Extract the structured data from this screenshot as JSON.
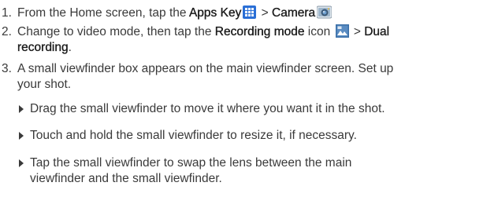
{
  "steps": [
    {
      "num": "1.",
      "p1": "From the Home screen, tap the ",
      "apps_key": "Apps Key",
      "p2": " > ",
      "camera": "Camera"
    },
    {
      "num": "2.",
      "p1": "Change to video mode, then tap the ",
      "recording_mode": "Recording mode",
      "p2": " icon ",
      "p3": " > ",
      "dual_recording_a": "Dual",
      "dual_recording_b": "recording",
      "p4": "."
    },
    {
      "num": "3.",
      "line1": "A small viewfinder box appears on the main viewfinder screen. Set up",
      "line2": "your shot."
    }
  ],
  "bullets": [
    {
      "line1": "Drag the small viewfinder to move it where you want it in the shot."
    },
    {
      "line1": "Touch and hold the small viewfinder to resize it, if necessary."
    },
    {
      "line1": "Tap the small viewfinder to swap the lens between the main",
      "line2": "viewfinder and the small viewfinder."
    }
  ],
  "colors": {
    "apps_icon": "#2a6fd6",
    "camera_icon": "#6a9ac0",
    "recording_icon": "#3b6fa8"
  },
  "icons": [
    "apps-key-icon",
    "camera-icon",
    "recording-mode-icon"
  ]
}
